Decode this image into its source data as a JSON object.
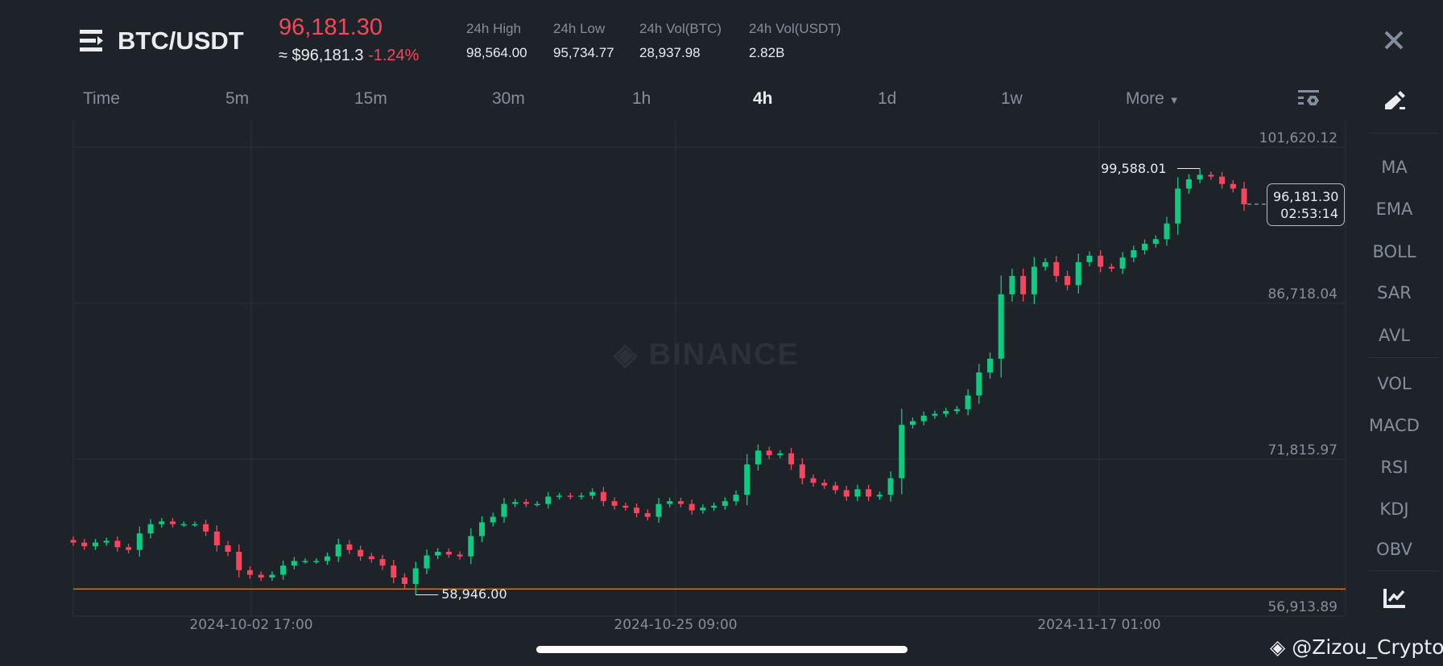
{
  "header": {
    "pair": "BTC/USDT",
    "price": "96,181.30",
    "approx": "≈ $96,181.3",
    "change": "-1.24%",
    "stats": [
      {
        "label": "24h High",
        "value": "98,564.00"
      },
      {
        "label": "24h Low",
        "value": "95,734.77"
      },
      {
        "label": "24h Vol(BTC)",
        "value": "28,937.98"
      },
      {
        "label": "24h Vol(USDT)",
        "value": "2.82B"
      }
    ]
  },
  "tabs": [
    "Time",
    "5m",
    "15m",
    "30m",
    "1h",
    "4h",
    "1d",
    "1w",
    "More"
  ],
  "active_tab": "4h",
  "sidebar": {
    "indicators_main": [
      "MA",
      "EMA",
      "BOLL",
      "SAR",
      "AVL"
    ],
    "indicators_sub": [
      "VOL",
      "MACD",
      "RSI",
      "KDJ",
      "OBV"
    ]
  },
  "current": {
    "price": "96,181.30",
    "countdown": "02:53:14"
  },
  "watermark": "BINANCE",
  "credit": "@Zizou_Crypto",
  "colors": {
    "up": "#0ecb81",
    "down": "#f6465d",
    "bg": "#1e2329",
    "grid": "#2b3139",
    "orange": "#f0850a"
  },
  "chart_data": {
    "type": "candlestick",
    "interval": "4h",
    "ylim": [
      56913.89,
      101620.12
    ],
    "y_ticks": [
      "101,620.12",
      "86,718.04",
      "71,815.97",
      "56,913.89"
    ],
    "x_ticks": [
      "2024-10-02 17:00",
      "2024-10-25 09:00",
      "2024-11-17 01:00"
    ],
    "high_label": "99,588.01",
    "high_value": 99588.01,
    "low_label": "58,946.00",
    "low_value": 58946.0,
    "horizontal_line": 59500,
    "closes": [
      63927,
      63576,
      63927,
      64100,
      63488,
      63224,
      64803,
      65680,
      65943,
      65680,
      65680,
      65680,
      64979,
      63663,
      63050,
      61297,
      60858,
      60595,
      60858,
      61735,
      62173,
      62173,
      62173,
      62611,
      63751,
      63224,
      62611,
      62348,
      61735,
      60595,
      59982,
      61472,
      62699,
      63050,
      62787,
      62611,
      64540,
      65855,
      66381,
      67609,
      67785,
      67609,
      67609,
      68310,
      68398,
      68310,
      68398,
      68749,
      67872,
      67434,
      67258,
      66732,
      66381,
      67609,
      67872,
      67609,
      66995,
      67258,
      67434,
      67872,
      68486,
      71378,
      72693,
      72255,
      72430,
      71378,
      70063,
      69625,
      69362,
      68924,
      68310,
      69012,
      68310,
      68486,
      70063,
      75147,
      75498,
      76024,
      76200,
      76463,
      76638,
      77953,
      80144,
      81459,
      87594,
      89348,
      87594,
      90224,
      90662,
      89348,
      88471,
      90662,
      91276,
      90224,
      90048,
      91100,
      91802,
      92415,
      92854,
      94345,
      97676,
      98553,
      98991,
      98816,
      98114,
      97676,
      96181
    ]
  }
}
